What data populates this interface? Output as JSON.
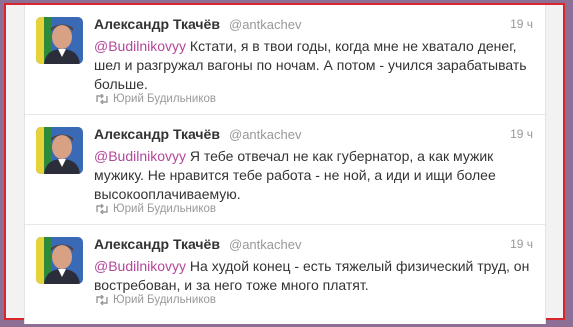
{
  "tweets": [
    {
      "name": "Александр Ткачёв",
      "handle": "@antkachev",
      "time": "19 ч",
      "mention": "@Budilnikovyy",
      "text": "Кстати, я в твои годы, когда мне не хватало денег, шел и разгружал вагоны по ночам. А потом - учился зарабатывать больше.",
      "retweeted_by": "Юрий Будильников"
    },
    {
      "name": "Александр Ткачёв",
      "handle": "@antkachev",
      "time": "19 ч",
      "mention": "@Budilnikovyy",
      "text": "Я тебе отвечал не как губернатор, а как мужик мужику. Не нравится тебе работа - не ной, а иди и ищи более высокооплачиваемую.",
      "retweeted_by": "Юрий Будильников"
    },
    {
      "name": "Александр Ткачёв",
      "handle": "@antkachev",
      "time": "19 ч",
      "mention": "@Budilnikovyy",
      "text": "На худой конец - есть тяжелый физический труд, он востребован, и за него тоже много платят.",
      "retweeted_by": "Юрий Будильников"
    }
  ],
  "colors": {
    "mention": "#b3479a",
    "frame_border": "#d8262c",
    "background": "#8d6f95"
  },
  "icons": [
    "avatar-photo",
    "retweet-icon"
  ]
}
